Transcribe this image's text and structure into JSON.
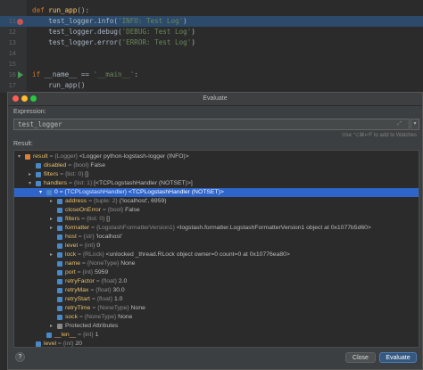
{
  "editor": {
    "lines": [
      {
        "num": "",
        "parts": [
          {
            "cls": "kw",
            "t": "def "
          },
          {
            "cls": "fn",
            "t": "run_app"
          },
          {
            "cls": "",
            "t": "():"
          }
        ],
        "hl": false,
        "mark": "none"
      },
      {
        "num": "11",
        "parts": [
          {
            "cls": "",
            "t": "    test_logger.info("
          },
          {
            "cls": "str",
            "t": "'INFO: Test Log'"
          },
          {
            "cls": "",
            "t": ")"
          }
        ],
        "hl": true,
        "mark": "breakpoint"
      },
      {
        "num": "12",
        "parts": [
          {
            "cls": "",
            "t": "    test_logger.debug("
          },
          {
            "cls": "str",
            "t": "'DEBUG: Test Log'"
          },
          {
            "cls": "",
            "t": ")"
          }
        ],
        "hl": false,
        "mark": "none"
      },
      {
        "num": "13",
        "parts": [
          {
            "cls": "",
            "t": "    test_logger.error("
          },
          {
            "cls": "str",
            "t": "'ERROR: Test Log'"
          },
          {
            "cls": "",
            "t": ")"
          }
        ],
        "hl": false,
        "mark": "none"
      },
      {
        "num": "14",
        "parts": [],
        "hl": false,
        "mark": "none"
      },
      {
        "num": "15",
        "parts": [],
        "hl": false,
        "mark": "none"
      },
      {
        "num": "16",
        "parts": [
          {
            "cls": "kw",
            "t": "if "
          },
          {
            "cls": "",
            "t": "__name__ == "
          },
          {
            "cls": "str",
            "t": "'__main__'"
          },
          {
            "cls": "",
            "t": ":"
          }
        ],
        "hl": false,
        "mark": "run"
      },
      {
        "num": "17",
        "parts": [
          {
            "cls": "",
            "t": "    run_app()"
          }
        ],
        "hl": false,
        "mark": "none"
      }
    ]
  },
  "dialog": {
    "title": "Evaluate",
    "expression_label": "Expression:",
    "expression_value": "test_logger",
    "hint": "Use ⌥⌘↵F to add to Watches",
    "result_label": "Result:",
    "help_label": "?",
    "close_label": "Close",
    "evaluate_label": "Evaluate"
  },
  "tree": [
    {
      "indent": 0,
      "arrow": "▾",
      "icon": "orange",
      "name": "result",
      "type": " = {Logger} ",
      "value": "<Logger python-logstash-logger (INFO)>",
      "sel": false
    },
    {
      "indent": 1,
      "arrow": "",
      "icon": "blue",
      "name": "disabled",
      "type": " = {bool} ",
      "value": "False",
      "sel": false
    },
    {
      "indent": 1,
      "arrow": "▸",
      "icon": "blue",
      "name": "filters",
      "type": " = {list: 0} ",
      "value": "[]",
      "sel": false
    },
    {
      "indent": 1,
      "arrow": "▾",
      "icon": "blue",
      "name": "handlers",
      "type": " = {list: 1} ",
      "value": "[<TCPLogstashHandler (NOTSET)>]",
      "sel": false
    },
    {
      "indent": 2,
      "arrow": "▾",
      "icon": "blue",
      "name": "0",
      "type": " = {TCPLogstashHandler} ",
      "value": "<TCPLogstashHandler (NOTSET)>",
      "sel": true
    },
    {
      "indent": 3,
      "arrow": "▸",
      "icon": "blue",
      "name": "address",
      "type": " = {tuple: 2} ",
      "value": "('localhost', 6959)",
      "sel": false
    },
    {
      "indent": 3,
      "arrow": "",
      "icon": "blue",
      "name": "closeOnError",
      "type": " = {bool} ",
      "value": "False",
      "sel": false
    },
    {
      "indent": 3,
      "arrow": "▸",
      "icon": "blue",
      "name": "filters",
      "type": " = {list: 0} ",
      "value": "[]",
      "sel": false
    },
    {
      "indent": 3,
      "arrow": "▸",
      "icon": "blue",
      "name": "formatter",
      "type": " = {LogstashFormatterVersion1} ",
      "value": "<logstash.formatter.LogstashFormatterVersion1 object at 0x1077b5d60>",
      "sel": false
    },
    {
      "indent": 3,
      "arrow": "",
      "icon": "blue",
      "name": "host",
      "type": " = {str} ",
      "value": "'localhost'",
      "sel": false
    },
    {
      "indent": 3,
      "arrow": "",
      "icon": "blue",
      "name": "level",
      "type": " = {int} ",
      "value": "0",
      "sel": false
    },
    {
      "indent": 3,
      "arrow": "▸",
      "icon": "blue",
      "name": "lock",
      "type": " = {RLock} ",
      "value": "<unlocked _thread.RLock object owner=0 count=0 at 0x10776ea80>",
      "sel": false
    },
    {
      "indent": 3,
      "arrow": "",
      "icon": "blue",
      "name": "name",
      "type": " = {NoneType} ",
      "value": "None",
      "sel": false
    },
    {
      "indent": 3,
      "arrow": "",
      "icon": "blue",
      "name": "port",
      "type": " = {int} ",
      "value": "5959",
      "sel": false
    },
    {
      "indent": 3,
      "arrow": "",
      "icon": "blue",
      "name": "retryFactor",
      "type": " = {float} ",
      "value": "2.0",
      "sel": false
    },
    {
      "indent": 3,
      "arrow": "",
      "icon": "blue",
      "name": "retryMax",
      "type": " = {float} ",
      "value": "30.0",
      "sel": false
    },
    {
      "indent": 3,
      "arrow": "",
      "icon": "blue",
      "name": "retryStart",
      "type": " = {float} ",
      "value": "1.0",
      "sel": false
    },
    {
      "indent": 3,
      "arrow": "",
      "icon": "blue",
      "name": "retryTime",
      "type": " = {NoneType} ",
      "value": "None",
      "sel": false
    },
    {
      "indent": 3,
      "arrow": "",
      "icon": "blue",
      "name": "sock",
      "type": " = {NoneType} ",
      "value": "None",
      "sel": false
    },
    {
      "indent": 3,
      "arrow": "▸",
      "icon": "list",
      "name": "",
      "type": "",
      "value": "Protected Attributes",
      "sel": false
    },
    {
      "indent": 2,
      "arrow": "",
      "icon": "blue",
      "name": "__len__",
      "type": " = {int} ",
      "value": "1",
      "sel": false
    },
    {
      "indent": 1,
      "arrow": "",
      "icon": "blue",
      "name": "level",
      "type": " = {int} ",
      "value": "20",
      "sel": false
    }
  ],
  "colors": {
    "selection": "#2f65ca",
    "breakpoint": "#c75450",
    "run_marker": "#499c54",
    "evaluate_button": "#365880",
    "var_name": "#e8bf6a"
  },
  "icons": {
    "help": "question-icon",
    "expand": "expand-icon",
    "dropdown": "chevron-down-icon"
  }
}
